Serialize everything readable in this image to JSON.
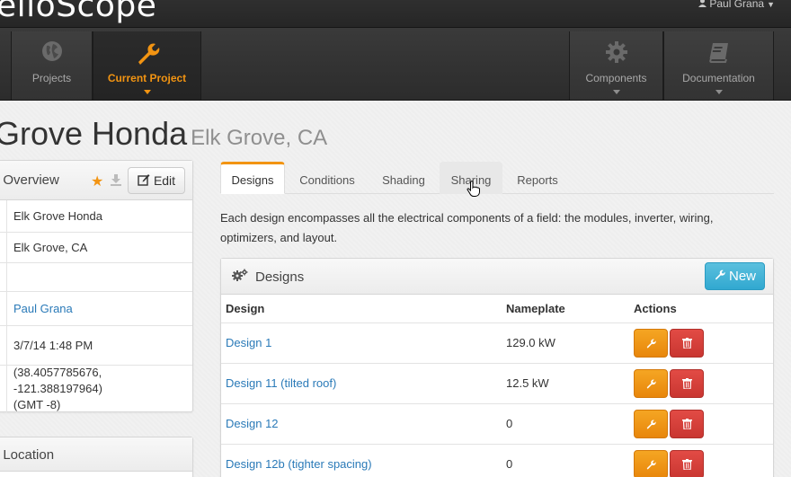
{
  "app": {
    "brand": "elloScope",
    "user": "Paul Grana"
  },
  "nav": {
    "projects": "Projects",
    "current_project": "Current Project",
    "components": "Components",
    "documentation": "Documentation"
  },
  "project": {
    "name": "Grove Honda",
    "location": "Elk Grove, CA"
  },
  "overview": {
    "title": "t Overview",
    "edit_label": "Edit",
    "rows": [
      "Elk Grove Honda",
      "Elk Grove, CA",
      "",
      "Paul Grana",
      "3/7/14 1:48 PM",
      "(38.4057785676, -121.388197964)",
      "(GMT -8)"
    ]
  },
  "location_panel": {
    "title": "t Location"
  },
  "tabs": [
    "Designs",
    "Conditions",
    "Shading",
    "Sharing",
    "Reports"
  ],
  "description": "Each design encompasses all the electrical components of a field: the modules, inverter, wiring, optimizers, and layout.",
  "designs": {
    "title": "Designs",
    "new_label": "New",
    "columns": [
      "Design",
      "Nameplate",
      "Actions"
    ],
    "rows": [
      {
        "name": "Design 1",
        "nameplate": "129.0 kW"
      },
      {
        "name": "Design 11 (tilted roof)",
        "nameplate": "12.5 kW"
      },
      {
        "name": "Design 12",
        "nameplate": "0"
      },
      {
        "name": "Design 12b (tighter spacing)",
        "nameplate": "0"
      }
    ]
  },
  "colors": {
    "accent": "#f29412",
    "link": "#2a7ab8",
    "info": "#5bc0de",
    "danger": "#d9534f"
  }
}
